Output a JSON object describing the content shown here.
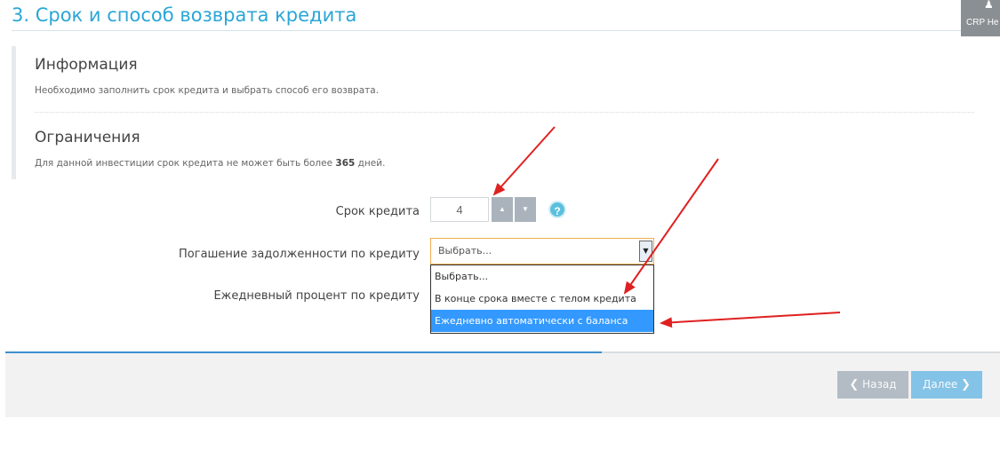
{
  "header": {
    "title": "3. Срок и способ возврата кредита",
    "badge_label": "CRP He",
    "badge_icon": "users-icon"
  },
  "info": {
    "title": "Информация",
    "text": "Необходимо заполнить срок кредита и выбрать способ его возврата."
  },
  "limits": {
    "title": "Ограничения",
    "text_before": "Для данной инвестиции срок кредита не может быть более ",
    "max_days": "365",
    "text_after": " дней."
  },
  "form": {
    "term_label": "Срок кредита",
    "term_value": "4",
    "help_label": "?",
    "repayment_label": "Погашение задолженности по кредиту",
    "repayment_value": "Выбрать...",
    "repayment_options": [
      "Выбрать...",
      "В конце срока вместе с телом кредита",
      "Ежедневно автоматически с баланса"
    ],
    "highlighted_option_index": 2,
    "daily_rate_label": "Ежедневный процент по кредиту"
  },
  "progress": {
    "fraction": 0.6
  },
  "footer": {
    "back_label": "Назад",
    "next_label": "Далее"
  },
  "colors": {
    "accent": "#2aa6d6",
    "select_border": "#f0ad4e",
    "highlight": "#3399ff",
    "annotation_arrow": "#e02020"
  }
}
